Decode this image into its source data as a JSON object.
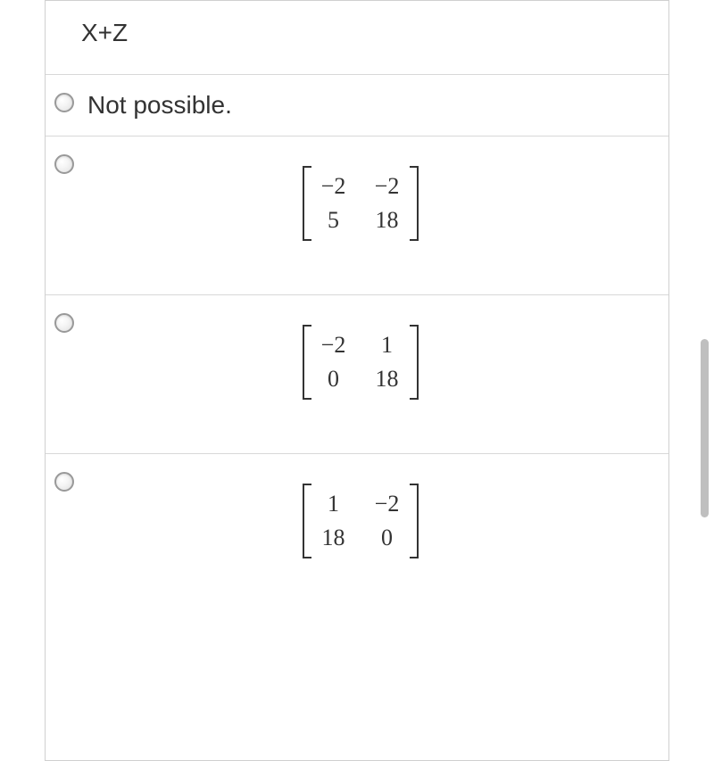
{
  "question": "X+Z",
  "options": [
    {
      "type": "text",
      "label": "Not possible."
    },
    {
      "type": "matrix",
      "cells": [
        "−2",
        "−2",
        "5",
        "18"
      ]
    },
    {
      "type": "matrix",
      "cells": [
        "−2",
        "1",
        "0",
        "18"
      ]
    },
    {
      "type": "matrix",
      "cells": [
        "1",
        "−2",
        "18",
        "0"
      ]
    }
  ]
}
